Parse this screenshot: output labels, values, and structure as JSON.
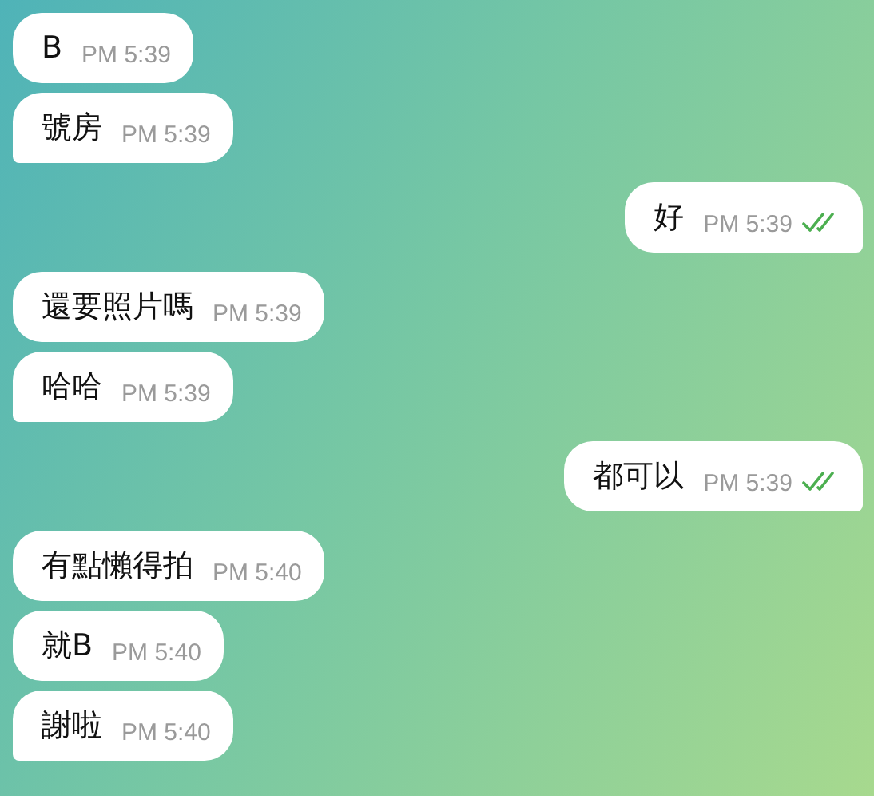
{
  "messages": [
    {
      "kind": "incoming",
      "text": "B",
      "time": "PM 5:39",
      "tail": false
    },
    {
      "kind": "incoming",
      "text": "號房",
      "time": "PM 5:39",
      "tail": true
    },
    {
      "kind": "outgoing",
      "text": "好",
      "time": "PM 5:39",
      "tail": true,
      "read": true
    },
    {
      "kind": "incoming",
      "text": "還要照片嗎",
      "time": "PM 5:39",
      "tail": false
    },
    {
      "kind": "incoming",
      "text": "哈哈",
      "time": "PM 5:39",
      "tail": true
    },
    {
      "kind": "outgoing",
      "text": "都可以",
      "time": "PM 5:39",
      "tail": true,
      "read": true
    },
    {
      "kind": "incoming",
      "text": "有點懶得拍",
      "time": "PM 5:40",
      "tail": false
    },
    {
      "kind": "incoming",
      "text": "就B",
      "time": "PM 5:40",
      "tail": false
    },
    {
      "kind": "incoming",
      "text": "謝啦",
      "time": "PM 5:40",
      "tail": true
    }
  ]
}
